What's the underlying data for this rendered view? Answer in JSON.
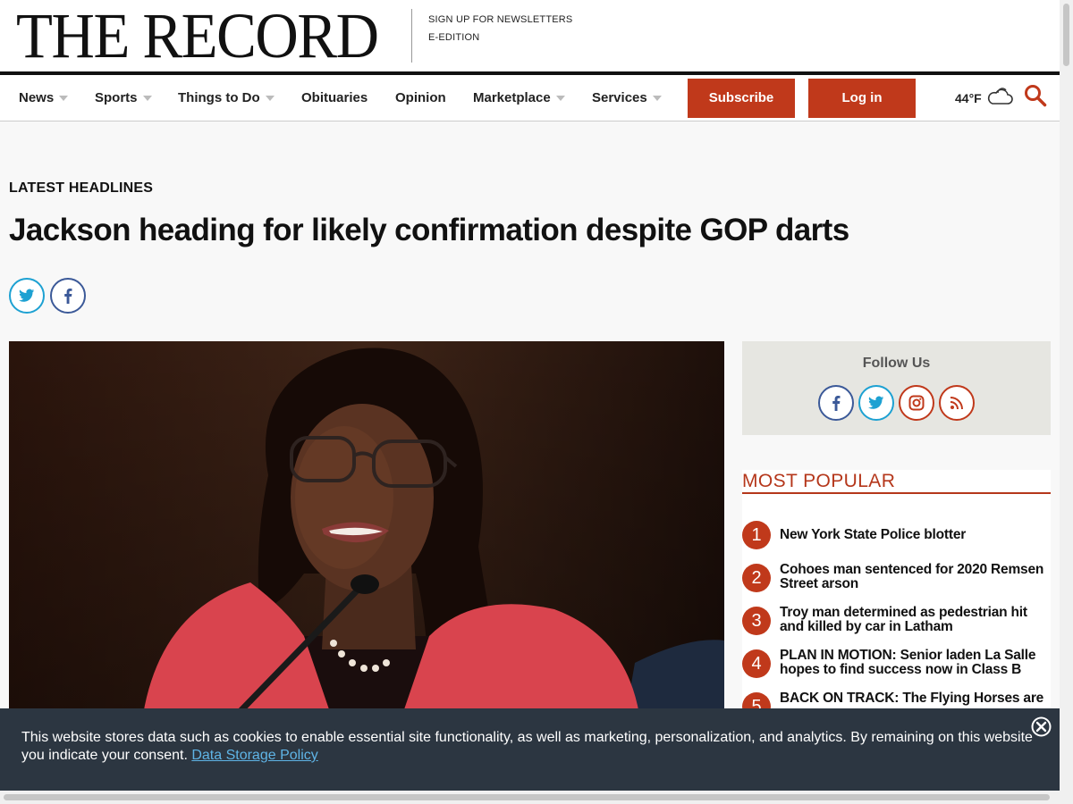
{
  "masthead": {
    "logo": "THE RECORD",
    "links": [
      "SIGN UP FOR NEWSLETTERS",
      "E-EDITION"
    ]
  },
  "nav": {
    "items": [
      {
        "label": "News",
        "dropdown": true
      },
      {
        "label": "Sports",
        "dropdown": true
      },
      {
        "label": "Things to Do",
        "dropdown": true
      },
      {
        "label": "Obituaries",
        "dropdown": false
      },
      {
        "label": "Opinion",
        "dropdown": false
      },
      {
        "label": "Marketplace",
        "dropdown": true
      },
      {
        "label": "Services",
        "dropdown": true
      }
    ],
    "subscribe_label": "Subscribe",
    "login_label": "Log in",
    "weather": "44°F",
    "weather_icon": "cloud-icon",
    "search_icon": "search-icon"
  },
  "article": {
    "section_label": "LATEST HEADLINES",
    "headline": "Jackson heading for likely confirmation despite GOP darts",
    "share_icons": [
      "twitter-icon",
      "facebook-icon"
    ]
  },
  "sidebar": {
    "follow_title": "Follow Us",
    "social_icons": [
      "facebook-icon",
      "twitter-icon",
      "instagram-icon",
      "rss-icon"
    ],
    "popular_title": "MOST POPULAR",
    "popular": [
      {
        "num": "1",
        "text": "New York State Police blotter"
      },
      {
        "num": "2",
        "text": "Cohoes man sentenced for 2020 Remsen Street arson"
      },
      {
        "num": "3",
        "text": "Troy man determined as pedestrian hit and killed by car in Latham"
      },
      {
        "num": "4",
        "text": "PLAN IN MOTION: Senior laden La Salle hopes to find success now in Class B"
      },
      {
        "num": "5",
        "text": "BACK ON TRACK: The Flying Horses are"
      }
    ]
  },
  "cookie": {
    "text": "This website stores data such as cookies to enable essential site functionality, as well as marketing, personalization, and analytics. By remaining on this website you indicate your consent.",
    "link": "Data Storage Policy"
  },
  "colors": {
    "accent": "#c0391b",
    "popular_title": "#b5371b",
    "twitter": "#1da1d2",
    "facebook": "#3b5998",
    "instagram": "#c0391b",
    "rss": "#c0391b",
    "cookie_bg": "#2c3641",
    "cookie_link": "#5fb4e6"
  }
}
